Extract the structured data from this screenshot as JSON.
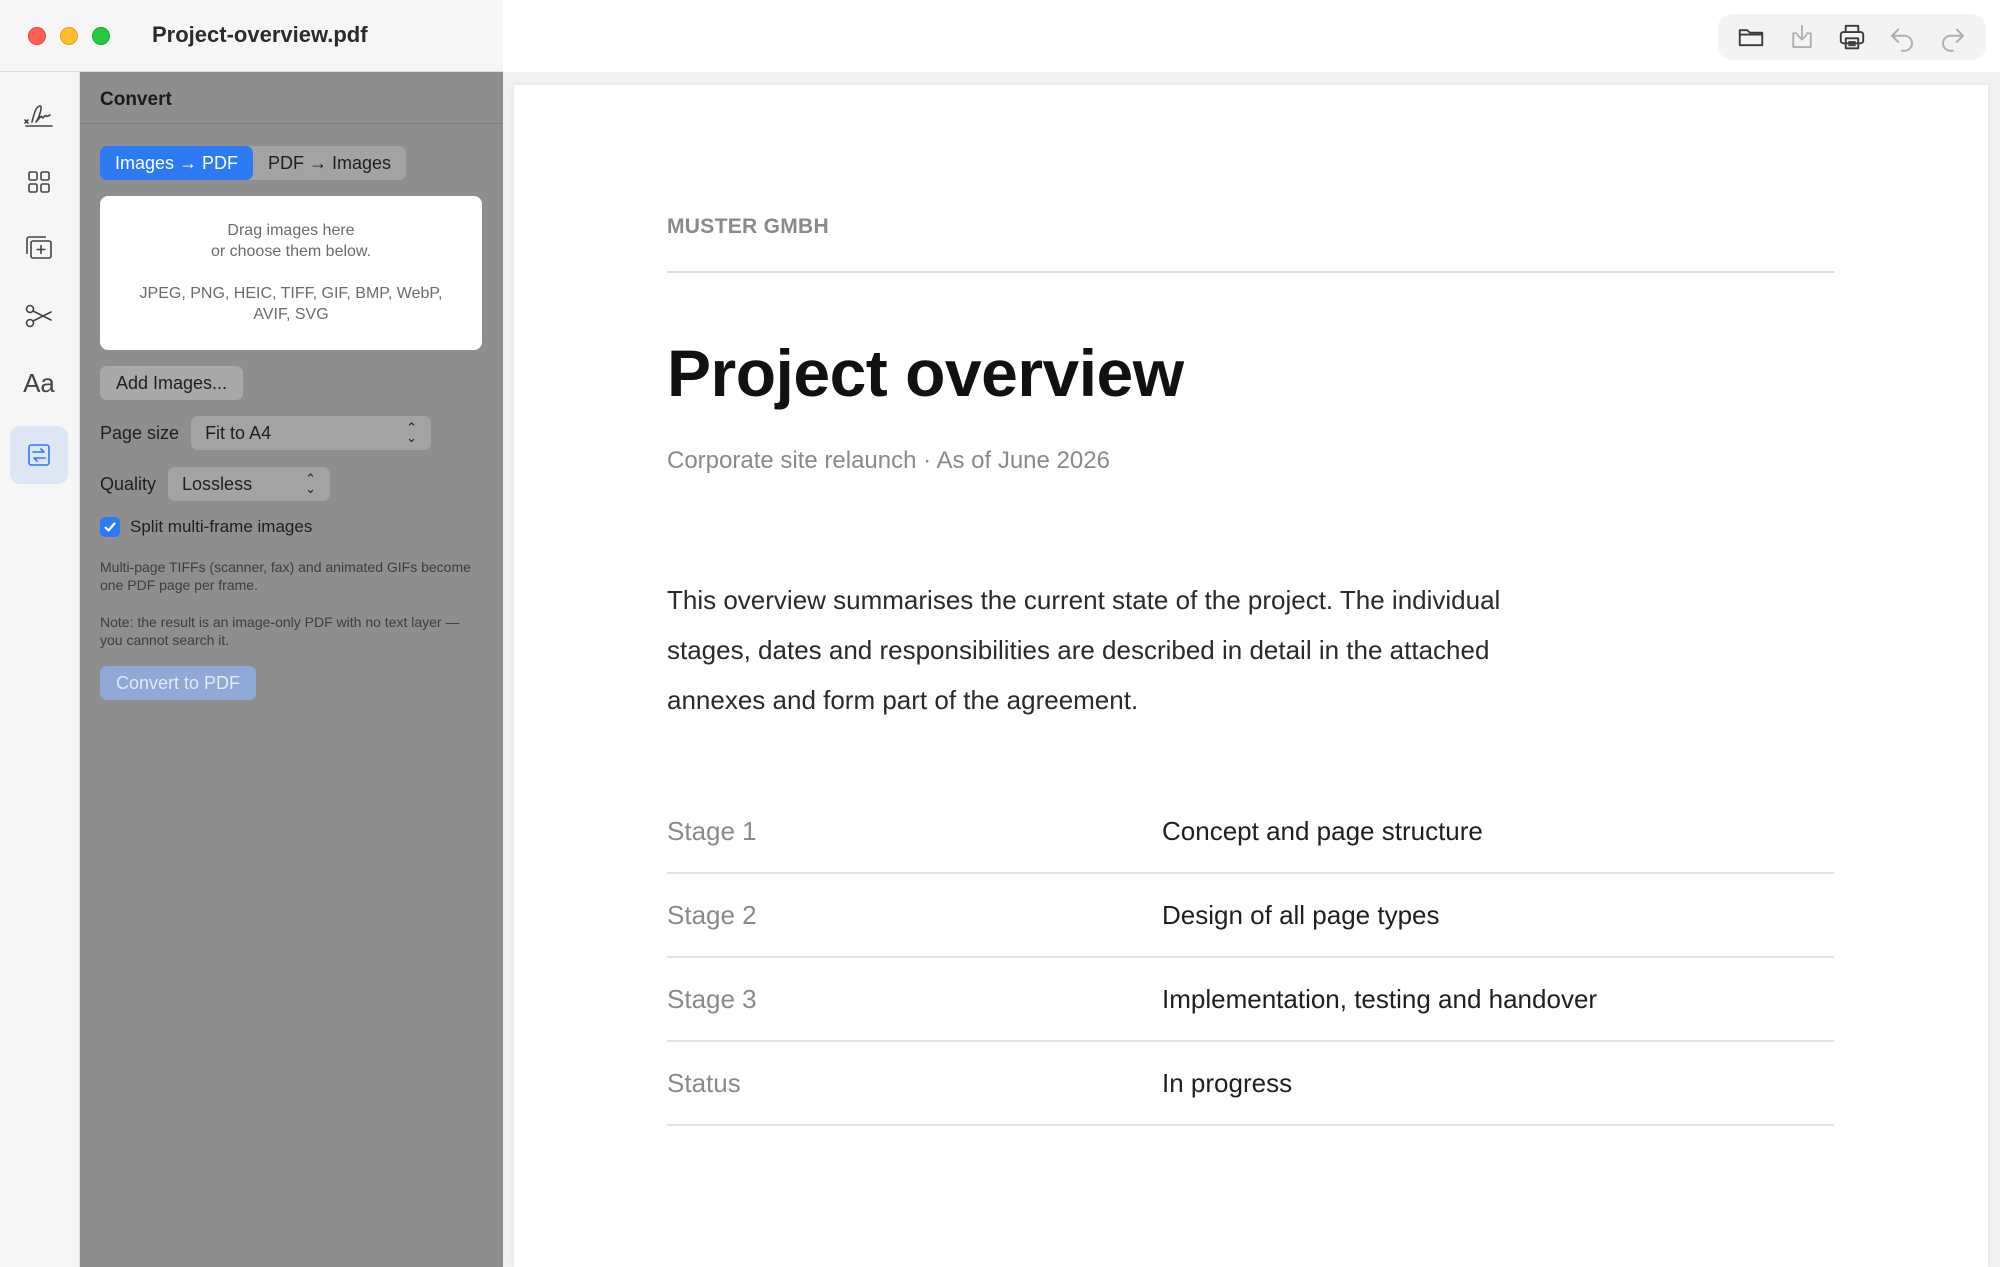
{
  "window": {
    "title": "Project-overview.pdf"
  },
  "toolbar": {
    "buttons": [
      {
        "name": "open-folder",
        "icon": "folder-icon"
      },
      {
        "name": "save",
        "icon": "download-icon"
      },
      {
        "name": "print",
        "icon": "printer-icon"
      },
      {
        "name": "undo",
        "icon": "undo-icon"
      },
      {
        "name": "redo",
        "icon": "redo-icon"
      }
    ]
  },
  "rail": {
    "items": [
      {
        "name": "signature",
        "icon": "signature-icon"
      },
      {
        "name": "grid",
        "icon": "grid-icon"
      },
      {
        "name": "add-pages",
        "icon": "add-pages-icon"
      },
      {
        "name": "cut",
        "icon": "scissors-icon"
      },
      {
        "name": "text",
        "icon": "text-icon",
        "label": "Aa"
      },
      {
        "name": "convert",
        "icon": "convert-icon",
        "active": true
      }
    ]
  },
  "panel": {
    "title": "Convert",
    "tabs": [
      {
        "label": "Images → PDF",
        "active": true
      },
      {
        "label": "PDF → Images",
        "active": false
      }
    ],
    "dropzone": {
      "line1": "Drag images here",
      "line2": "or choose them below.",
      "formats": "JPEG, PNG, HEIC, TIFF, GIF, BMP, WebP, AVIF, SVG"
    },
    "add_images_label": "Add Images...",
    "page_size": {
      "label": "Page size",
      "value": "Fit to A4"
    },
    "quality": {
      "label": "Quality",
      "value": "Lossless"
    },
    "split": {
      "label": "Split multi-frame images",
      "checked": true
    },
    "hint1": "Multi-page TIFFs (scanner, fax) and animated GIFs become one PDF page per frame.",
    "hint2": "Note: the result is an image-only PDF with no text layer — you cannot search it.",
    "convert_label": "Convert to PDF"
  },
  "document": {
    "company": "MUSTER GMBH",
    "heading": "Project overview",
    "subtitle": "Corporate site relaunch · As of June 2026",
    "body": "This overview summarises the current state of the project. The individual stages, dates and responsibilities are described in detail in the attached annexes and form part of the agreement.",
    "rows": [
      {
        "key": "Stage 1",
        "value": "Concept and page structure"
      },
      {
        "key": "Stage 2",
        "value": "Design of all page types"
      },
      {
        "key": "Stage 3",
        "value": "Implementation, testing and handover"
      },
      {
        "key": "Status",
        "value": "In progress"
      }
    ]
  },
  "colors": {
    "accent": "#2d7bf4",
    "panel": "#8e8e8e",
    "close": "#ff5f57",
    "minimize": "#febc2e",
    "zoom": "#28c840"
  }
}
